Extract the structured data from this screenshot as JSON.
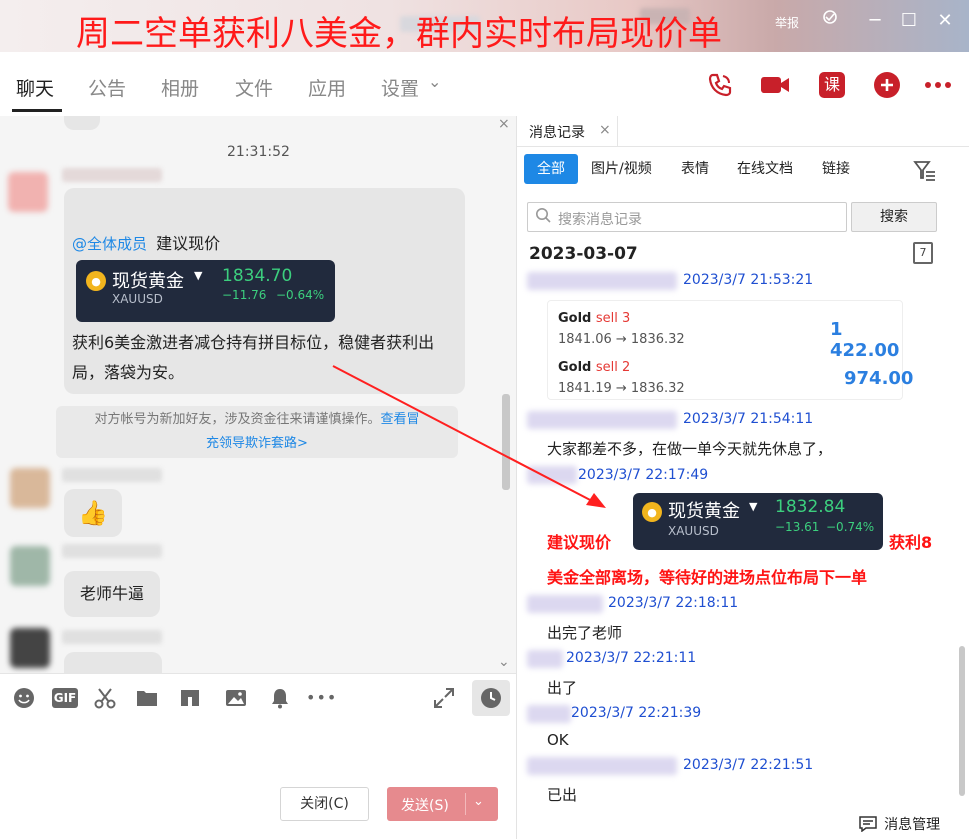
{
  "banner": {
    "title": "周二空单获利八美金，群内实时布局现价单",
    "report_label": "举报",
    "minimize": "─",
    "maximize": "☐",
    "close": "✕"
  },
  "nav": {
    "tabs": [
      {
        "label": "聊天"
      },
      {
        "label": "公告"
      },
      {
        "label": "相册"
      },
      {
        "label": "文件"
      },
      {
        "label": "应用"
      },
      {
        "label": "设置"
      }
    ],
    "settings_chevron": "⌄",
    "course_label": "课",
    "accent_color": "#c8202a"
  },
  "chat": {
    "time": "21:31:52",
    "mention": "@全体成员",
    "suggest": "建议现价",
    "card1": {
      "name": "现货黄金",
      "symbol": "XAUUSD",
      "price": "1834.70",
      "change": "−11.76",
      "percent": "−0.64%"
    },
    "profit_text_1": "获利6美金激进者减仓持有拼目标位，稳健者获利出",
    "profit_text_2": "局，落袋为安。",
    "warn_1": "对方帐号为新加好友，涉及资金往来请谨慎操作。",
    "warn_link_1": "查看冒",
    "warn_link_2": "充领导欺诈套路>",
    "thumbs": "👍",
    "teacher_msg": "老师牛逼"
  },
  "toolbar": {
    "gif": "GIF",
    "more": "•••"
  },
  "buttons": {
    "close": "关闭(C)",
    "send": "发送(S)",
    "send_arrow": "⌄"
  },
  "history": {
    "tab_label": "消息记录",
    "tab_close": "×",
    "filters": [
      "全部",
      "图片/视频",
      "表情",
      "在线文档",
      "链接"
    ],
    "search_placeholder": "搜索消息记录",
    "search_button": "搜索",
    "date": "2023-03-07",
    "calendar_day": "7",
    "entries": [
      {
        "ts": "2023/3/7 21:53:21"
      },
      {
        "ts": "2023/3/7 21:54:11",
        "text": "大家都差不多，在做一单今天就先休息了，"
      },
      {
        "ts": "2023/3/7 22:17:49"
      },
      {
        "ts": "2023/3/7 22:18:11",
        "text": "出完了老师"
      },
      {
        "ts": "2023/3/7 22:21:11",
        "text": "出了"
      },
      {
        "ts": "2023/3/7 22:21:39",
        "text": "OK"
      },
      {
        "ts": "2023/3/7 22:21:51",
        "text": "已出"
      }
    ],
    "trades": [
      {
        "label": "Gold",
        "side": "sell 3",
        "range": "1841.06 → 1836.32",
        "value": "1 422.00"
      },
      {
        "label": "Gold",
        "side": "sell 2",
        "range": "1841.19 → 1836.32",
        "value": "974.00"
      }
    ],
    "card2": {
      "name": "现货黄金",
      "symbol": "XAUUSD",
      "price": "1832.84",
      "change": "−13.61",
      "percent": "−0.74%"
    },
    "annot_left": "建议现价",
    "annot_right": "获利8",
    "annot_line2": "美金全部离场，等待好的进场点位布局下一单",
    "manage_label": "消息管理"
  }
}
